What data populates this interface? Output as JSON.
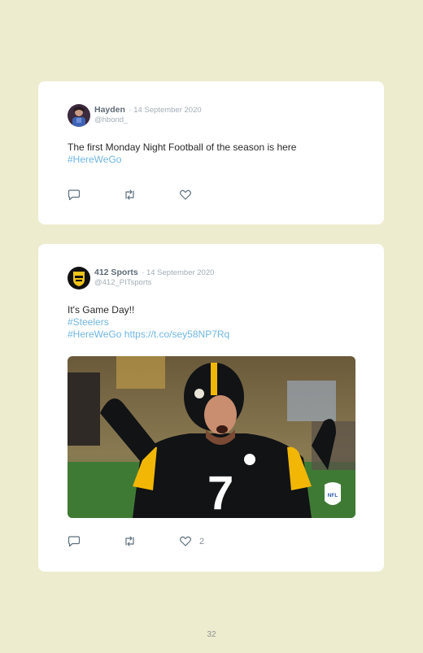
{
  "tweets": [
    {
      "author": "Hayden",
      "date": "· 14 September 2020",
      "handle": "@hbond_",
      "text_lines": [
        "The first Monday Night Football of the season is here"
      ],
      "link_lines": [
        "#HereWeGo"
      ],
      "likes": ""
    },
    {
      "author": "412 Sports",
      "date": "· 14 September 2020",
      "handle": "@412_PITsports",
      "text_lines": [
        "It's Game Day!!"
      ],
      "link_lines": [
        "#Steelers",
        "#HereWeGo https://t.co/sey58NP7Rq"
      ],
      "likes": "2",
      "media": {
        "jersey_number": "7",
        "logo_text": "NFL"
      }
    }
  ],
  "page_number": "32",
  "colors": {
    "background": "#eeeccf",
    "card": "#ffffff",
    "link": "#6fb7e0",
    "name": "#5f6b78",
    "muted": "#a3adb6"
  },
  "icons": [
    "reply-icon",
    "retweet-icon",
    "like-icon"
  ]
}
